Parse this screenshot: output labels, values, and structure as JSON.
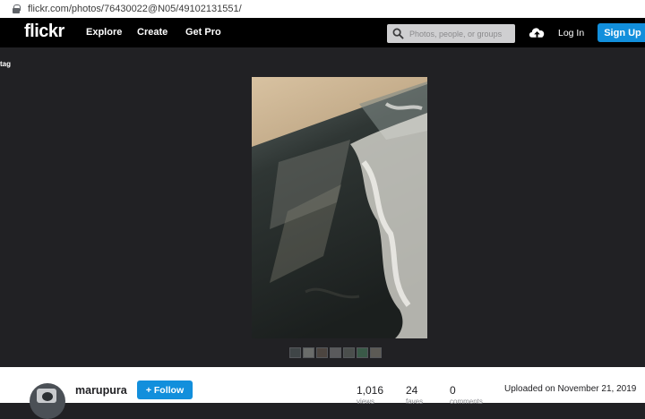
{
  "browser": {
    "url": "flickr.com/photos/76430022@N05/49102131551/"
  },
  "nav": {
    "logo": "flickr",
    "links": [
      "Explore",
      "Create",
      "Get Pro"
    ],
    "search_placeholder": "Photos, people, or groups",
    "login": "Log In",
    "signup": "Sign Up"
  },
  "stage": {
    "tag_label": "tag",
    "thumbnail_count": 7
  },
  "owner": {
    "username": "marupura",
    "follow_label": "+ Follow"
  },
  "stats": [
    {
      "value": "1,016",
      "label": "views"
    },
    {
      "value": "24",
      "label": "faves"
    },
    {
      "value": "0",
      "label": "comments"
    }
  ],
  "uploaded": "Uploaded on November 21, 2019",
  "colors": {
    "accent": "#128fdc",
    "nav_bg": "#000000",
    "stage_bg": "#212124"
  }
}
